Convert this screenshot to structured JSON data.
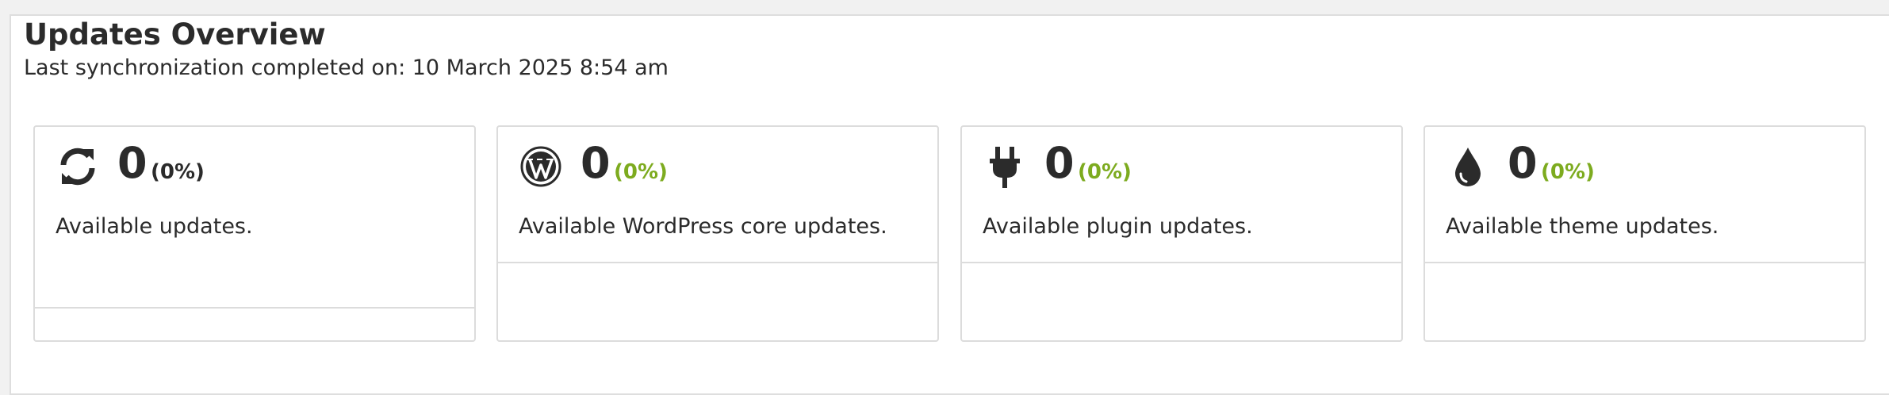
{
  "header": {
    "title": "Updates Overview",
    "subtitle": "Last synchronization completed on: 10 March 2025 8:54 am"
  },
  "cards": [
    {
      "icon": "sync-icon",
      "count": "0",
      "percent": "(0%)",
      "description": "Available updates."
    },
    {
      "icon": "wordpress-icon",
      "count": "0",
      "percent": "(0%)",
      "description": "Available WordPress core updates."
    },
    {
      "icon": "plug-icon",
      "count": "0",
      "percent": "(0%)",
      "description": "Available plugin updates."
    },
    {
      "icon": "droplet-icon",
      "count": "0",
      "percent": "(0%)",
      "description": "Available theme updates."
    }
  ],
  "colors": {
    "percent_green": "#7dab1f",
    "text": "#2b2b2b",
    "border": "#dcdcdc"
  }
}
